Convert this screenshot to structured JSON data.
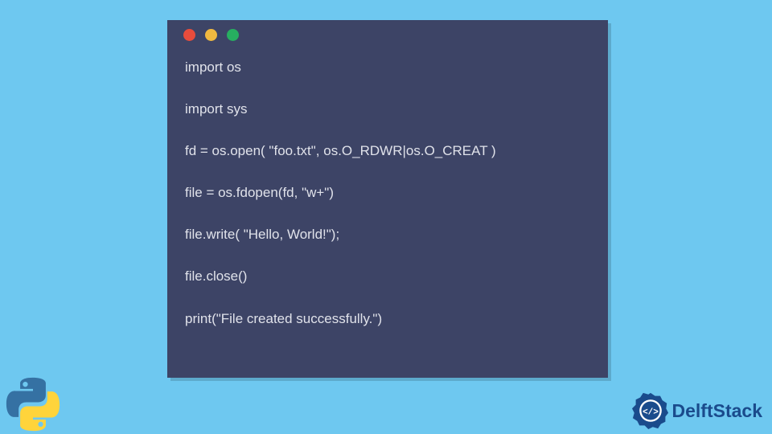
{
  "code": {
    "lines": [
      "import os",
      "import sys",
      "fd = os.open( \"foo.txt\", os.O_RDWR|os.O_CREAT )",
      "file = os.fdopen(fd, \"w+\")",
      "file.write( \"Hello, World!\");",
      "file.close()",
      "print(\"File created successfully.\")"
    ]
  },
  "brand": {
    "name": "DelftStack"
  },
  "window": {
    "dots": [
      "red",
      "yellow",
      "green"
    ]
  }
}
